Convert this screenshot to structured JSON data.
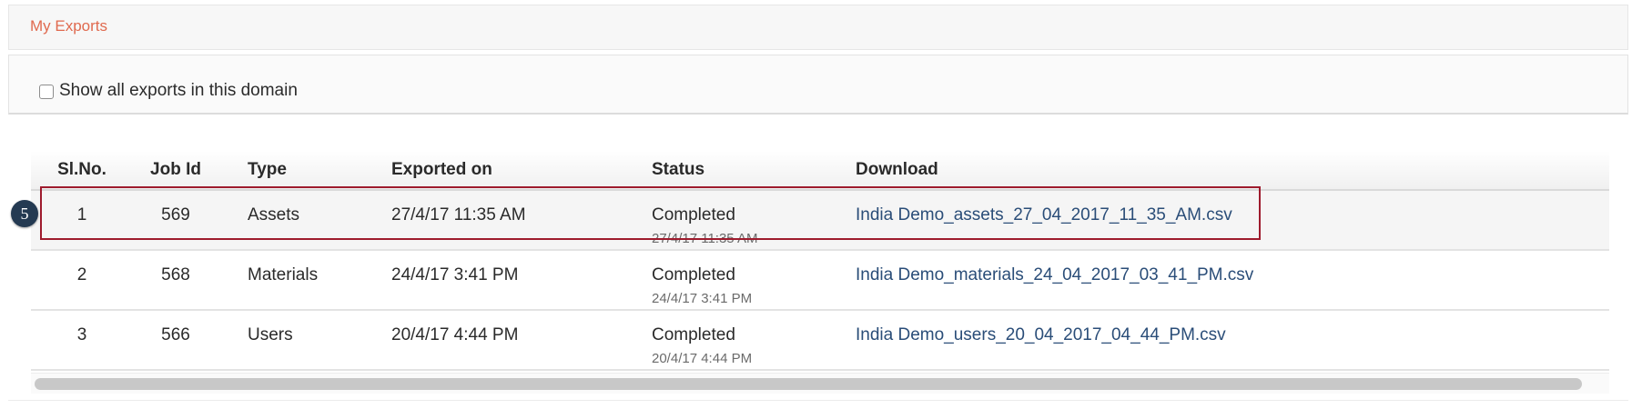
{
  "panel": {
    "title": "My Exports"
  },
  "filter": {
    "show_all_label": "Show all exports in this domain",
    "checked": false
  },
  "table": {
    "headers": {
      "sl_no": "Sl.No.",
      "job_id": "Job Id",
      "type": "Type",
      "exported_on": "Exported on",
      "status": "Status",
      "download": "Download"
    },
    "rows": [
      {
        "sl_no": "1",
        "job_id": "569",
        "type": "Assets",
        "exported_on": "27/4/17 11:35 AM",
        "status": "Completed",
        "status_time": "27/4/17 11:35 AM",
        "download": "India Demo_assets_27_04_2017_11_35_AM.csv"
      },
      {
        "sl_no": "2",
        "job_id": "568",
        "type": "Materials",
        "exported_on": "24/4/17 3:41 PM",
        "status": "Completed",
        "status_time": "24/4/17 3:41 PM",
        "download": "India Demo_materials_24_04_2017_03_41_PM.csv"
      },
      {
        "sl_no": "3",
        "job_id": "566",
        "type": "Users",
        "exported_on": "20/4/17 4:44 PM",
        "status": "Completed",
        "status_time": "20/4/17 4:44 PM",
        "download": "India Demo_users_20_04_2017_04_44_PM.csv"
      }
    ]
  },
  "callout": {
    "step_number": "5"
  },
  "colors": {
    "title_accent": "#e06a4f",
    "link": "#2a4d78",
    "highlight_border": "#9e1b2d",
    "badge_bg": "#243a52"
  }
}
